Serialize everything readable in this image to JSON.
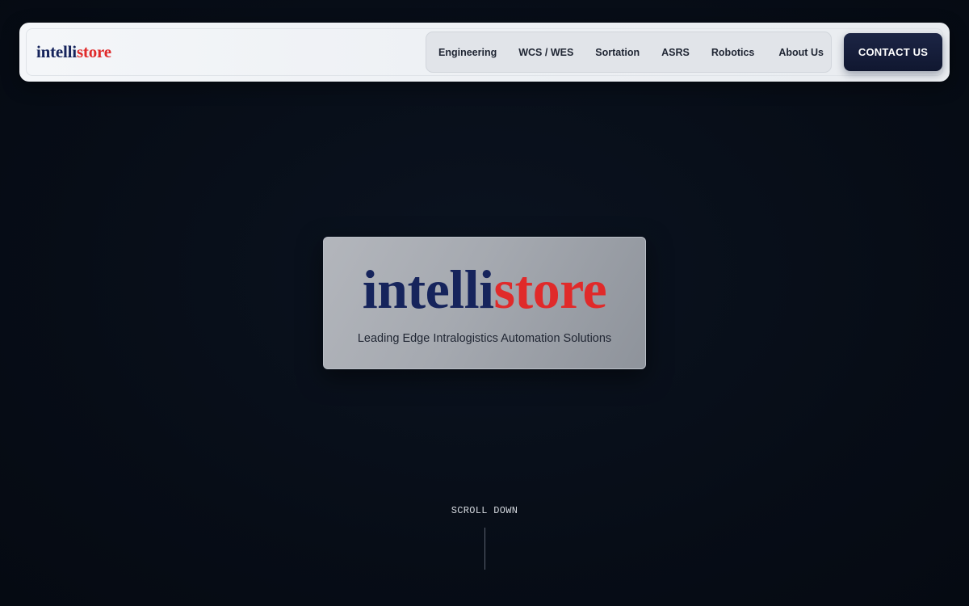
{
  "brand": {
    "part1": "intelli",
    "part2": "store"
  },
  "nav": {
    "items": [
      {
        "label": "Engineering"
      },
      {
        "label": "WCS / WES"
      },
      {
        "label": "Sortation"
      },
      {
        "label": "ASRS"
      },
      {
        "label": "Robotics"
      },
      {
        "label": "About Us"
      }
    ],
    "contact_label": "CONTACT US"
  },
  "hero": {
    "brand_part1": "intelli",
    "brand_part2": "store",
    "tagline": "Leading Edge Intralogistics Automation Solutions"
  },
  "scroll": {
    "label": "SCROLL DOWN"
  },
  "colors": {
    "brand_navy": "#16245c",
    "brand_red": "#e02a2a",
    "background": "#070d17",
    "contact_button": "#141c38"
  }
}
